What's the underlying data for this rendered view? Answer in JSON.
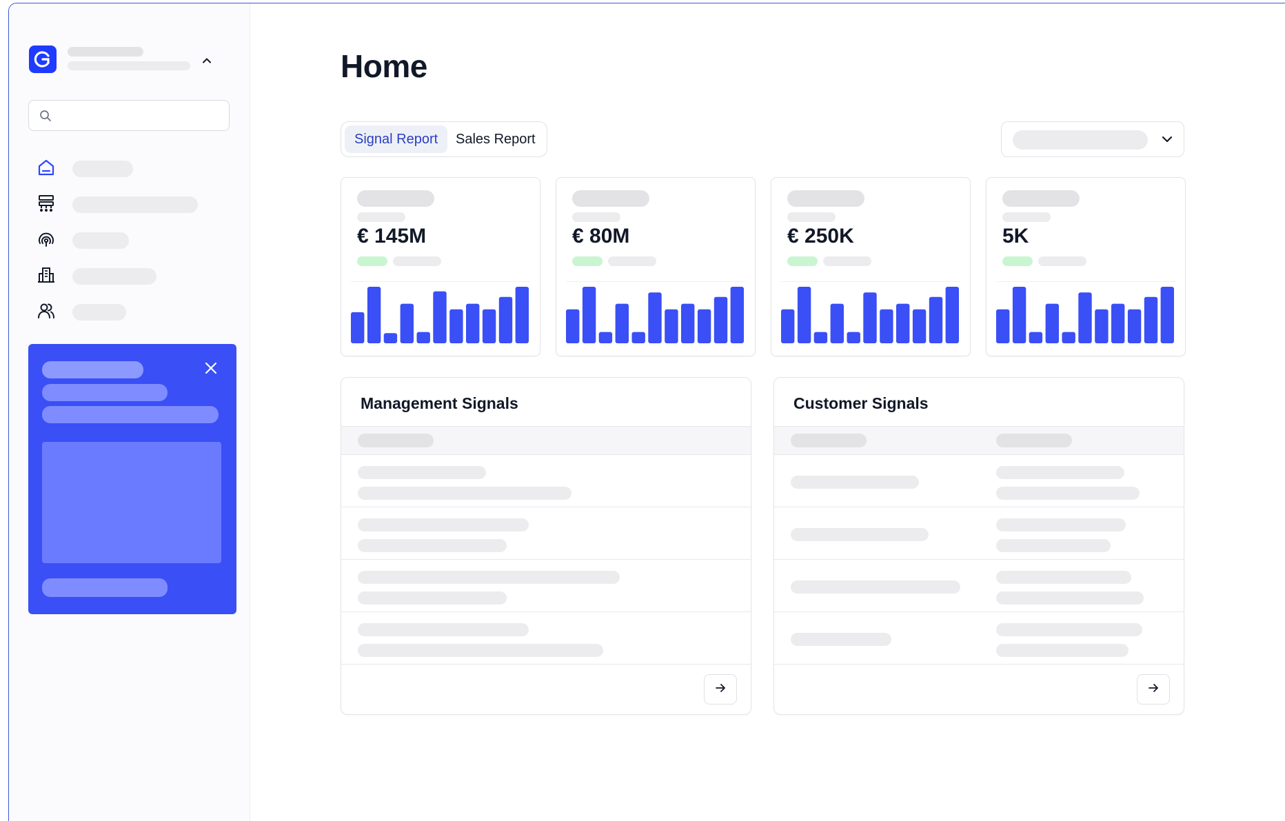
{
  "page": {
    "title": "Home"
  },
  "tabs": {
    "signal_report": "Signal Report",
    "sales_report": "Sales Report"
  },
  "search": {
    "placeholder": ""
  },
  "sidebar": {
    "nav_icons": [
      "home-icon",
      "sitemap-icon",
      "signal-icon",
      "building-icon",
      "users-icon"
    ]
  },
  "kpis": [
    {
      "value": "€ 145M"
    },
    {
      "value": "€ 80M"
    },
    {
      "value": "€ 250K"
    },
    {
      "value": "5K"
    }
  ],
  "cards": {
    "management_title": "Management Signals",
    "customer_title": "Customer Signals"
  },
  "colors": {
    "accent": "#3a4ff5",
    "brand": "#1f3bff",
    "bar": "#3a4ff5",
    "positive_pill": "#c9f5d1"
  },
  "chart_data": [
    {
      "type": "bar",
      "values": [
        0.55,
        1.0,
        0.18,
        0.7,
        0.2,
        0.92,
        0.6,
        0.7,
        0.6,
        0.82,
        1.0
      ],
      "ylim": [
        0,
        1
      ]
    },
    {
      "type": "bar",
      "values": [
        0.6,
        1.0,
        0.2,
        0.7,
        0.2,
        0.9,
        0.6,
        0.7,
        0.6,
        0.82,
        1.0
      ],
      "ylim": [
        0,
        1
      ]
    },
    {
      "type": "bar",
      "values": [
        0.6,
        1.0,
        0.2,
        0.7,
        0.2,
        0.9,
        0.6,
        0.7,
        0.6,
        0.82,
        1.0
      ],
      "ylim": [
        0,
        1
      ]
    },
    {
      "type": "bar",
      "values": [
        0.6,
        1.0,
        0.2,
        0.7,
        0.2,
        0.9,
        0.6,
        0.7,
        0.6,
        0.82,
        1.0
      ],
      "ylim": [
        0,
        1
      ]
    }
  ]
}
